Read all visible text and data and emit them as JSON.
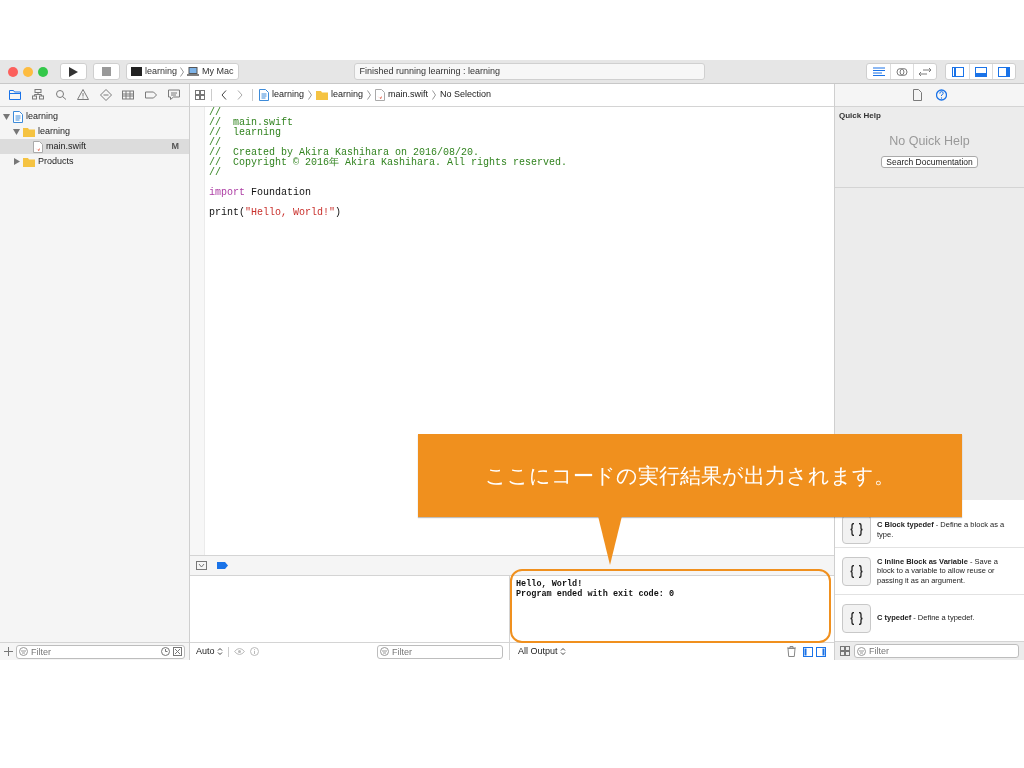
{
  "toolbar": {
    "scheme": [
      "learning",
      "My Mac"
    ],
    "status": "Finished running learning : learning",
    "editor_modes": [
      {
        "selected": true
      },
      {
        "selected": false
      },
      {
        "selected": false
      }
    ],
    "view_toggles": [
      {
        "on": true
      },
      {
        "on": true
      },
      {
        "on": true
      }
    ]
  },
  "navigator": {
    "tabs": [
      {
        "selected": true
      },
      {
        "selected": false
      },
      {
        "selected": false
      },
      {
        "selected": false
      },
      {
        "selected": false
      },
      {
        "selected": false
      },
      {
        "selected": false
      },
      {
        "selected": false
      }
    ],
    "tree": [
      {
        "label": "learning",
        "kind": "project",
        "expanded": true,
        "selected": false,
        "children": [
          {
            "label": "learning",
            "kind": "folder",
            "expanded": true,
            "selected": false,
            "children": [
              {
                "label": "main.swift",
                "kind": "file",
                "selected": true,
                "badge": "M"
              }
            ]
          },
          {
            "label": "Products",
            "kind": "folder",
            "expanded": false,
            "selected": false
          }
        ]
      }
    ],
    "filter": {
      "placeholder": "Filter"
    }
  },
  "editor": {
    "jump_bar": [
      {
        "label": "learning",
        "kind": "project"
      },
      {
        "label": "learning",
        "kind": "folder"
      },
      {
        "label": "main.swift",
        "kind": "file"
      },
      {
        "label": "No Selection",
        "kind": "plain"
      }
    ],
    "code_lines": [
      {
        "kind": "code",
        "tokens": [
          {
            "kind": "comment",
            "text": "//"
          }
        ]
      },
      {
        "kind": "code",
        "tokens": [
          {
            "kind": "comment",
            "text": "//  main.swift"
          }
        ]
      },
      {
        "kind": "code",
        "tokens": [
          {
            "kind": "comment",
            "text": "//  learning"
          }
        ]
      },
      {
        "kind": "code",
        "tokens": [
          {
            "kind": "comment",
            "text": "//"
          }
        ]
      },
      {
        "kind": "code",
        "tokens": [
          {
            "kind": "comment",
            "text": "//  Created by Akira Kashihara on 2016/08/20."
          }
        ]
      },
      {
        "kind": "code",
        "tokens": [
          {
            "kind": "comment",
            "text": "//  Copyright © 2016年 Akira Kashihara. All rights reserved."
          }
        ]
      },
      {
        "kind": "code",
        "tokens": [
          {
            "kind": "comment",
            "text": "//"
          }
        ]
      },
      {
        "kind": "blank"
      },
      {
        "kind": "code",
        "tokens": [
          {
            "kind": "keyword",
            "text": "import"
          },
          {
            "kind": "plain",
            "text": " Foundation"
          }
        ]
      },
      {
        "kind": "blank"
      },
      {
        "kind": "code",
        "tokens": [
          {
            "kind": "plain",
            "text": "print("
          },
          {
            "kind": "string",
            "text": "\"Hello, World!\""
          },
          {
            "kind": "plain",
            "text": ")"
          }
        ]
      }
    ]
  },
  "debug": {
    "variables_mode": "Auto",
    "variables_filter": {
      "placeholder": "Filter"
    },
    "output_mode": "All Output",
    "console_lines": [
      "Hello, World!",
      "Program ended with exit code: 0"
    ]
  },
  "inspector": {
    "tabs": [
      {
        "selected": false
      },
      {
        "selected": true
      }
    ],
    "quick_help": {
      "heading": "Quick Help",
      "message": "No Quick Help",
      "button": "Search Documentation"
    },
    "library": [
      {
        "title": "C Block typedef",
        "description": "- Define a block as a type."
      },
      {
        "title": "C Inline Block as Variable",
        "description": "- Save a block to a variable to allow reuse or passing it as an argument."
      },
      {
        "title": "C typedef",
        "description": "- Define a typedef."
      }
    ],
    "filter": {
      "placeholder": "Filter"
    }
  },
  "callout": {
    "text": "ここにコードの実行結果が出力されます。"
  }
}
